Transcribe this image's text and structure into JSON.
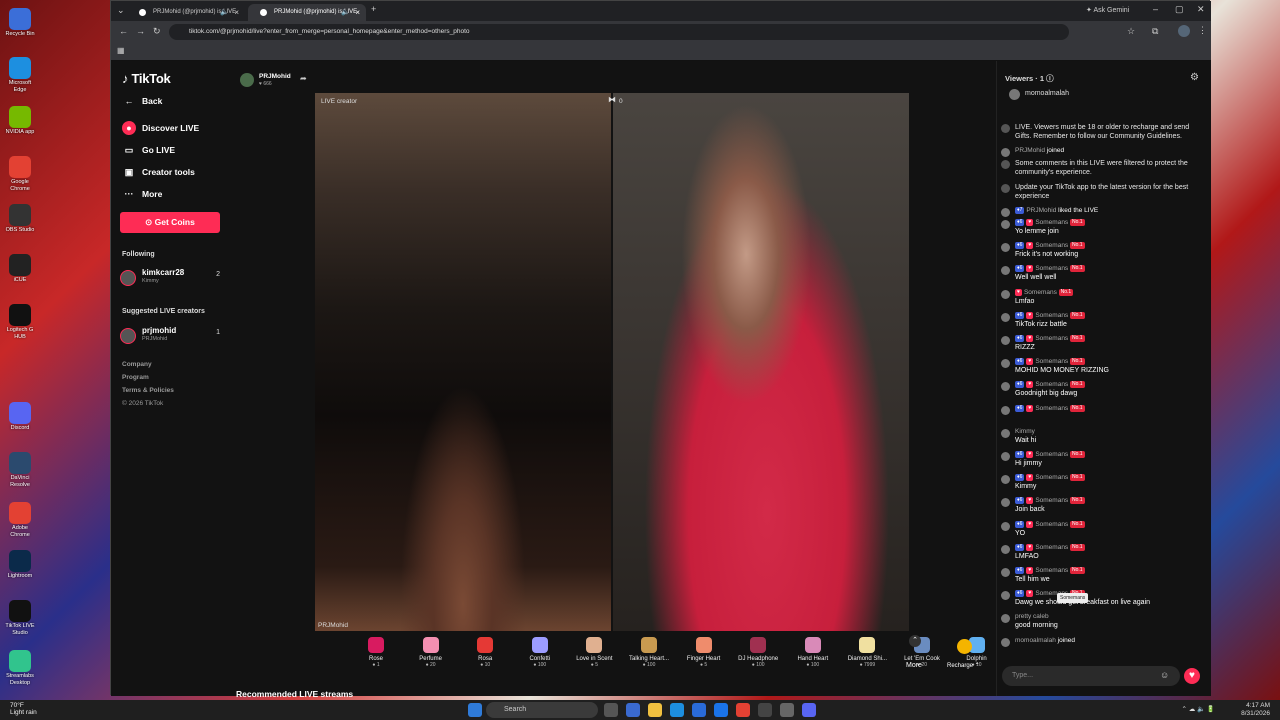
{
  "desktop": {
    "icons": [
      "Recycle Bin",
      "Microsoft Edge",
      "NVIDIA app",
      "Google Chrome",
      "OBS Studio",
      "iCUE",
      "Logitech G HUB",
      "Discord",
      "DaVinci Resolve",
      "Adobe Chrome",
      "Lightroom",
      "TikTok LIVE Studio",
      "Streamlabs Desktop"
    ]
  },
  "browser": {
    "tabs": [
      {
        "title": "PRJMohid (@prjmohid) is LIVE"
      },
      {
        "title": "PRJMohid (@prjmohid) is LIVE"
      }
    ],
    "ask_gemini": "Ask Gemini",
    "url": "tiktok.com/@prjmohid/live?enter_from_merge=personal_homepage&enter_method=others_photo"
  },
  "nav": {
    "logo": "TikTok",
    "back": "Back",
    "discover": "Discover LIVE",
    "go_live": "Go LIVE",
    "creator_tools": "Creator tools",
    "more": "More",
    "get_coins": "Get Coins",
    "following_title": "Following",
    "following": [
      {
        "name": "kimkcarr28",
        "sub": "Kimmy",
        "count": "2"
      }
    ],
    "suggested_title": "Suggested LIVE creators",
    "suggested": [
      {
        "name": "prjmohid",
        "sub": "PRJMohid",
        "count": "1"
      }
    ],
    "footer": [
      "Company",
      "Program",
      "Terms & Policies",
      "© 2026 TikTok"
    ]
  },
  "stream": {
    "host_name": "PRJMohid",
    "host_likes": "666",
    "left_label": "LIVE creator",
    "right_count": "0",
    "left_bottom": "PRJMohid",
    "gifts": [
      {
        "name": "Rose",
        "price": "1"
      },
      {
        "name": "Perfume",
        "price": "20"
      },
      {
        "name": "Rosa",
        "price": "10"
      },
      {
        "name": "Confetti",
        "price": "100"
      },
      {
        "name": "Love in Scent",
        "price": "5"
      },
      {
        "name": "Talking Heart...",
        "price": "100"
      },
      {
        "name": "Finger Heart",
        "price": "5"
      },
      {
        "name": "DJ Headphone",
        "price": "100"
      },
      {
        "name": "Hand Heart",
        "price": "100"
      },
      {
        "name": "Diamond Shi...",
        "price": "7999"
      },
      {
        "name": "Let 'Em Cook",
        "price": "20"
      },
      {
        "name": "Dolphin",
        "price": "10"
      }
    ],
    "more": "More",
    "recharge": "Recharge",
    "recommended": "Recommended LIVE streams"
  },
  "chat": {
    "viewers_label": "Viewers",
    "viewers_count": "1",
    "top_viewer": "momoalmalah",
    "messages": [
      {
        "system": "LIVE. Viewers must be 18 or older to recharge and send Gifts. Remember to follow our Community Guidelines."
      },
      {
        "user": "PRJMohid",
        "text": "joined",
        "inline": true
      },
      {
        "system": "Some comments in this LIVE were filtered to protect the community's experience."
      },
      {
        "system": "Update your TikTok app to the latest version for the best experience"
      },
      {
        "user": "PRJMohid",
        "text": "liked the LIVE",
        "inline": true,
        "level": "7"
      },
      {
        "user": "Somemans",
        "text": "Yo lemme join",
        "level": "6",
        "rank": "No.1"
      },
      {
        "user": "Somemans",
        "text": "Frick it's not working",
        "level": "6",
        "rank": "No.1"
      },
      {
        "user": "Somemans",
        "text": "Well well well",
        "level": "6",
        "rank": "No.1"
      },
      {
        "user": "Somemans",
        "text": "Lmfao",
        "rank": "No.1"
      },
      {
        "user": "Somemans",
        "text": "TikTok rizz battle",
        "level": "6",
        "rank": "No.1"
      },
      {
        "user": "Somemans",
        "text": "RIZZZ",
        "level": "6",
        "rank": "No.1"
      },
      {
        "user": "Somemans",
        "text": "MOHID MO MONEY RIZZING",
        "level": "6",
        "rank": "No.1"
      },
      {
        "user": "Somemans",
        "text": "Goodnight big dawg",
        "level": "6",
        "rank": "No.1"
      },
      {
        "user": "Somemans",
        "text": "",
        "level": "6",
        "rank": "No.1"
      },
      {
        "user": "Kimmy",
        "text": "Wait hi"
      },
      {
        "user": "Somemans",
        "text": "Hi jimmy",
        "level": "6",
        "rank": "No.1"
      },
      {
        "user": "Somemans",
        "text": "Kimmy",
        "level": "6",
        "rank": "No.1"
      },
      {
        "user": "Somemans",
        "text": "Join back",
        "level": "6",
        "rank": "No.1"
      },
      {
        "user": "Somemans",
        "text": "YO",
        "level": "6",
        "rank": "No.1"
      },
      {
        "user": "Somemans",
        "text": "LMFAO",
        "level": "6",
        "rank": "No.1"
      },
      {
        "user": "Somemans",
        "text": "Tell him we",
        "level": "6",
        "rank": "No.1"
      },
      {
        "user": "Somemans",
        "text": "Dawg we should get breakfast on live again",
        "level": "6",
        "rank": "No.1"
      },
      {
        "user": "pretty caleb",
        "text": "good morning"
      },
      {
        "user": "momoalmalah",
        "text": "joined",
        "inline": true
      }
    ],
    "tooltip": "Somemans",
    "input_placeholder": "Type..."
  },
  "taskbar": {
    "weather_temp": "70°F",
    "weather_desc": "Light rain",
    "search": "Search",
    "time": "4:17 AM",
    "date": "8/31/2026"
  },
  "colors": {
    "accent": "#fe2c55",
    "bg": "#121212"
  }
}
